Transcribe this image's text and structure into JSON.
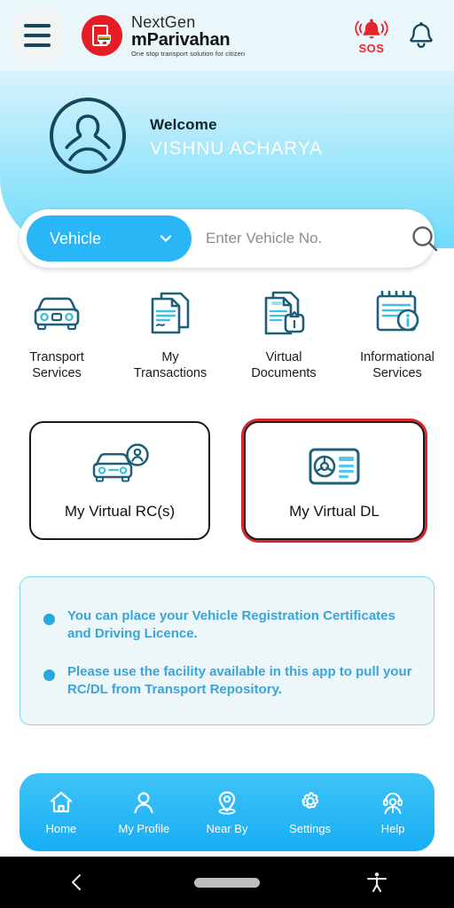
{
  "header": {
    "menu_icon": "hamburger-menu-icon",
    "brand_top": "NextGen",
    "brand_main": "mParivahan",
    "brand_tagline": "One stop transport solution for citizen",
    "sos_label": "SOS",
    "sos_icon": "alarm-bell-icon",
    "notification_icon": "bell-icon",
    "background": "#e9f7fb"
  },
  "banner": {
    "welcome_label": "Welcome",
    "user_name": "VISHNU ACHARYA",
    "avatar_icon": "user-avatar-icon",
    "gradient_from": "#d9f3fb",
    "gradient_to": "#6ddcfb"
  },
  "search": {
    "selected_type": "Vehicle",
    "chevron_icon": "chevron-down-icon",
    "placeholder": "Enter Vehicle No.",
    "value": "",
    "search_icon": "search-icon",
    "pill_color": "#29b6f6"
  },
  "quick_links": [
    {
      "label": "Transport\nServices",
      "label_line1": "Transport",
      "label_line2": "Services",
      "icon": "car-front-icon"
    },
    {
      "label": "My Transactions",
      "label_line1": "My",
      "label_line2": "Transactions",
      "icon": "documents-icon"
    },
    {
      "label": "Virtual Documents",
      "label_line1": "Virtual",
      "label_line2": "Documents",
      "icon": "document-upload-icon"
    },
    {
      "label": "Informational Services",
      "label_line1": "Informational",
      "label_line2": "Services",
      "icon": "notepad-info-icon"
    }
  ],
  "virtual_cards": [
    {
      "label": "My Virtual RC(s)",
      "icon": "car-user-icon",
      "selected": false
    },
    {
      "label": "My Virtual DL",
      "icon": "licence-card-icon",
      "selected": true,
      "highlight_color": "#d8272f"
    }
  ],
  "info_box": {
    "bullets": [
      "You can place your Vehicle Registration Certificates and Driving Licence.",
      "Please use the facility available in this app to pull your RC/DL from Transport Repository."
    ],
    "text_color": "#3aa5d8",
    "background": "#edf6f8",
    "border_color": "#7fd3ea"
  },
  "bottom_nav": [
    {
      "label": "Home",
      "icon": "home-icon",
      "active": true
    },
    {
      "label": "My Profile",
      "icon": "person-icon",
      "active": false
    },
    {
      "label": "Near By",
      "icon": "location-pin-icon",
      "active": false
    },
    {
      "label": "Settings",
      "icon": "gear-icon",
      "active": false
    },
    {
      "label": "Help",
      "icon": "headset-support-icon",
      "active": false
    }
  ],
  "system_bar": {
    "back_icon": "back-chevron-icon",
    "home_icon": "home-pill-icon",
    "accessibility_icon": "accessibility-icon"
  }
}
